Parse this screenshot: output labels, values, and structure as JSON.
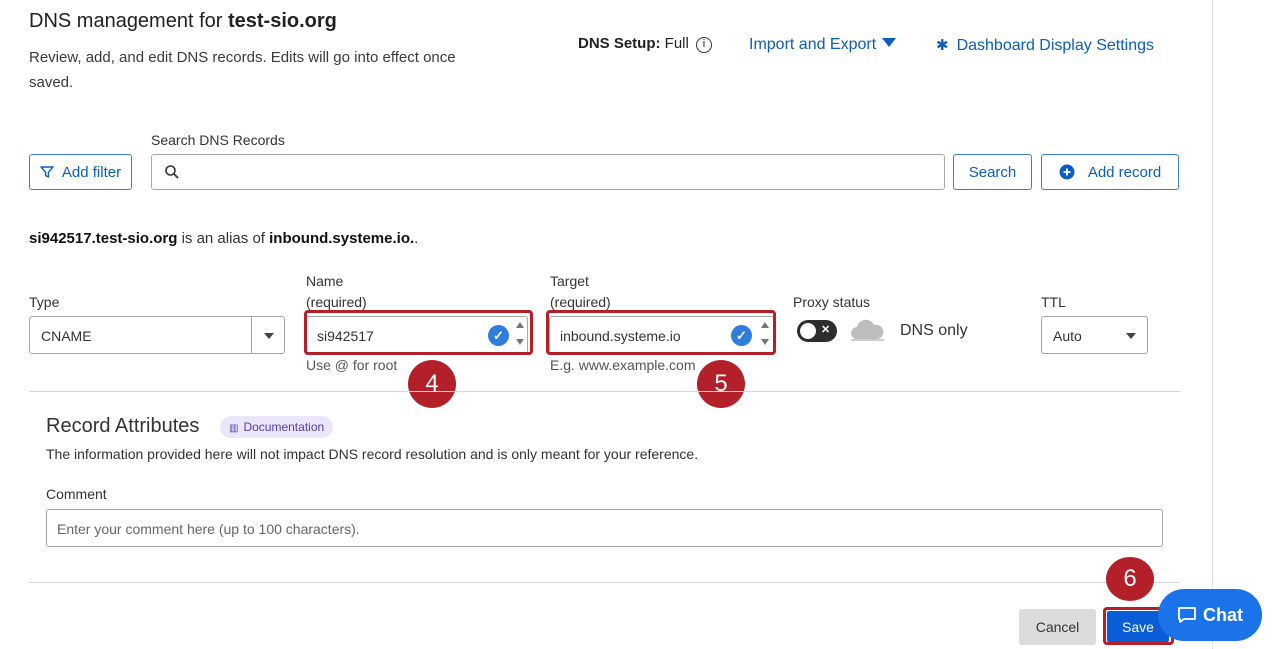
{
  "header": {
    "title_prefix": "DNS management for ",
    "domain": "test-sio.org",
    "description": "Review, add, and edit DNS records. Edits will go into effect once saved.",
    "dns_setup_label": "DNS Setup:",
    "dns_setup_value": "Full",
    "info_icon": "info-icon",
    "import_export_label": "Import and Export",
    "dashboard_settings_label": "Dashboard Display Settings"
  },
  "toolbar": {
    "add_filter_label": "Add filter",
    "search_label": "Search DNS Records",
    "search_value": "",
    "search_button_label": "Search",
    "add_record_label": "Add record"
  },
  "record": {
    "alias_host": "si942517.test-sio.org",
    "alias_middle": " is an alias of ",
    "alias_target": "inbound.systeme.io.",
    "alias_end": ".",
    "type_label": "Type",
    "type_value": "CNAME",
    "name_label": "Name",
    "name_required": "(required)",
    "name_value": "si942517",
    "name_hint": "Use @ for root",
    "target_label": "Target",
    "target_required": "(required)",
    "target_value": "inbound.systeme.io",
    "target_hint": "E.g. www.example.com",
    "proxy_label": "Proxy status",
    "proxy_value": "DNS only",
    "ttl_label": "TTL",
    "ttl_value": "Auto"
  },
  "attributes": {
    "title": "Record Attributes",
    "documentation_label": "Documentation",
    "description": "The information provided here will not impact DNS record resolution and is only meant for your reference.",
    "comment_label": "Comment",
    "comment_placeholder": "Enter your comment here (up to 100 characters)."
  },
  "actions": {
    "cancel_label": "Cancel",
    "save_label": "Save",
    "chat_label": "Chat"
  },
  "steps": [
    "4",
    "5",
    "6"
  ],
  "colors": {
    "link": "#0a5dc2",
    "primary": "#0a5dd6",
    "highlight": "#b3202a",
    "chat": "#1a73e8"
  }
}
